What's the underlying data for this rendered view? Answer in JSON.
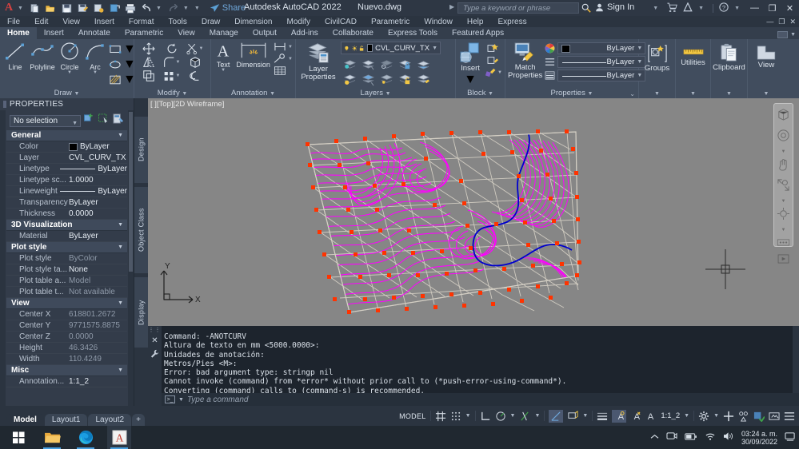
{
  "titlebar": {
    "app_logo": "autocad-A-logo",
    "title": "Autodesk AutoCAD 2022",
    "filename": "Nuevo.dwg",
    "share_label": "Share",
    "search_placeholder": "Type a keyword or phrase",
    "signin_label": "Sign In",
    "quick_access": [
      "new-icon",
      "open-icon",
      "save-icon",
      "saveas-icon",
      "plot-icon",
      "plot-preview-icon",
      "print-icon",
      "undo-icon",
      "redo-icon",
      "customize-icon"
    ],
    "window_buttons": [
      "minimize",
      "restore",
      "close"
    ]
  },
  "menubar": {
    "items": [
      "File",
      "Edit",
      "View",
      "Insert",
      "Format",
      "Tools",
      "Draw",
      "Dimension",
      "Modify",
      "CivilCAD",
      "Parametric",
      "Window",
      "Help",
      "Express"
    ],
    "window_buttons": [
      "minimize",
      "restore",
      "close"
    ]
  },
  "ribbon": {
    "tabs": [
      "Home",
      "Insert",
      "Annotate",
      "Parametric",
      "View",
      "Manage",
      "Output",
      "Add-ins",
      "Collaborate",
      "Express Tools",
      "Featured Apps"
    ],
    "active_tab": "Home",
    "panels": [
      {
        "name": "Draw",
        "title": "Draw",
        "tools": [
          {
            "label": "Line",
            "icon": "line-icon",
            "has_dropdown": false
          },
          {
            "label": "Polyline",
            "icon": "polyline-icon",
            "has_dropdown": false
          },
          {
            "label": "Circle",
            "icon": "circle-icon",
            "has_dropdown": true
          },
          {
            "label": "Arc",
            "icon": "arc-icon",
            "has_dropdown": true
          }
        ],
        "small_tools": [
          "rectangle-icon",
          "ellipse-icon",
          "hatch-icon"
        ]
      },
      {
        "name": "Modify",
        "title": "Modify",
        "small_tools": [
          "move-icon",
          "rotate-icon",
          "trim-icon",
          "copy-icon",
          "mirror-icon",
          "fillet-icon",
          "stretch-icon",
          "scale-icon",
          "array-icon",
          "offset-icon",
          "explode-icon",
          "erase-icon"
        ]
      },
      {
        "name": "Annotation",
        "title": "Annotation",
        "tools": [
          {
            "label": "Text",
            "icon": "text-icon",
            "has_dropdown": true
          },
          {
            "label": "Dimension",
            "icon": "dimension-icon",
            "has_dropdown": false
          }
        ],
        "small_tools": [
          "leader-icon",
          "multileader-icon",
          "table-icon"
        ]
      },
      {
        "name": "Layers",
        "title": "Layers",
        "big_button": {
          "label": "Layer\nProperties",
          "line1": "Layer",
          "line2": "Properties",
          "icon": "layer-properties-icon"
        },
        "layer_combo": {
          "value": "CVL_CURV_TX",
          "color_swatch": "#000000",
          "state_icons": [
            "lightbulb-on-icon",
            "freeze-sun-icon",
            "unlock-icon"
          ]
        },
        "small_tools": [
          "layer-isolate-icon",
          "layer-freeze-icon",
          "layer-off-icon",
          "layer-lock-icon",
          "layer-merge-icon",
          "layer-on-icon",
          "layer-thaw-icon",
          "layer-unisolate-icon",
          "layer-unlock-icon",
          "layer-match-icon"
        ]
      },
      {
        "name": "Block",
        "title": "Block",
        "big_button": {
          "line1": "Insert",
          "line2": "",
          "icon": "insert-block-icon",
          "has_dropdown": true
        },
        "small_tools": [
          "create-block-icon",
          "edit-block-icon",
          "edit-attributes-icon"
        ]
      },
      {
        "name": "Properties",
        "title": "Properties",
        "big_button": {
          "line1": "Match",
          "line2": "Properties",
          "icon": "match-properties-icon"
        },
        "rows": [
          {
            "icon": "color-wheel-icon",
            "swatch": "#000000",
            "value": "ByLayer"
          },
          {
            "icon": "linetype-icon",
            "value": "ByLayer"
          },
          {
            "icon": "lineweight-icon",
            "value": "ByLayer"
          }
        ]
      },
      {
        "name": "Groups",
        "title": "Groups",
        "big_button": {
          "line1": "Groups",
          "icon": "groups-icon"
        }
      },
      {
        "name": "Utilities",
        "title": "Utilities",
        "big_button": {
          "line1": "Utilities",
          "icon": "ruler-icon"
        }
      },
      {
        "name": "Clipboard",
        "title": "Clipboard",
        "big_button": {
          "line1": "Clipboard",
          "icon": "clipboard-icon"
        }
      },
      {
        "name": "View",
        "title": "View",
        "big_button": {
          "line1": "View",
          "icon": "view-icon"
        }
      }
    ]
  },
  "properties_palette": {
    "title": "PROPERTIES",
    "selection": "No selection",
    "toolbar_icons": [
      "quick-select-icon",
      "select-objects-icon",
      "quick-calc-icon"
    ],
    "groups": [
      {
        "name": "General",
        "rows": [
          {
            "key": "Color",
            "value": "ByLayer",
            "type": "color",
            "swatch": "#000000"
          },
          {
            "key": "Layer",
            "value": "CVL_CURV_TX",
            "type": "text"
          },
          {
            "key": "Linetype",
            "value": "ByLayer",
            "type": "line"
          },
          {
            "key": "Linetype sc...",
            "value": "1.0000",
            "type": "text"
          },
          {
            "key": "Lineweight",
            "value": "ByLayer",
            "type": "line"
          },
          {
            "key": "Transparency",
            "value": "ByLayer",
            "type": "text"
          },
          {
            "key": "Thickness",
            "value": "0.0000",
            "type": "text"
          }
        ]
      },
      {
        "name": "3D Visualization",
        "rows": [
          {
            "key": "Material",
            "value": "ByLayer",
            "type": "text"
          }
        ]
      },
      {
        "name": "Plot style",
        "rows": [
          {
            "key": "Plot style",
            "value": "ByColor",
            "type": "dim"
          },
          {
            "key": "Plot style ta...",
            "value": "None",
            "type": "text"
          },
          {
            "key": "Plot table a...",
            "value": "Model",
            "type": "dim"
          },
          {
            "key": "Plot table t...",
            "value": "Not available",
            "type": "dim"
          }
        ]
      },
      {
        "name": "View",
        "rows": [
          {
            "key": "Center X",
            "value": "618801.2672",
            "type": "dim"
          },
          {
            "key": "Center Y",
            "value": "9771575.8875",
            "type": "dim"
          },
          {
            "key": "Center Z",
            "value": "0.0000",
            "type": "dim"
          },
          {
            "key": "Height",
            "value": "46.3426",
            "type": "dim"
          },
          {
            "key": "Width",
            "value": "110.4249",
            "type": "dim"
          }
        ]
      },
      {
        "name": "Misc",
        "rows": [
          {
            "key": "Annotation...",
            "value": "1:1_2",
            "type": "text"
          }
        ]
      }
    ]
  },
  "side_tabs": [
    "Design",
    "Object Class",
    "Display"
  ],
  "canvas": {
    "viewport_label": "[ ][Top][2D Wireframe]",
    "ucs_x_label": "X",
    "ucs_y_label": "Y",
    "background_color": "#868686",
    "contour_color": "#ff00ff",
    "river_color": "#0000cd",
    "triangle_color": "#d4cfc4",
    "point_color": "#ff3300",
    "navbar_icons": [
      "viewcube-icon",
      "steering-wheel-icon",
      "pan-icon",
      "zoom-icon",
      "orbit-icon",
      "showmotion-icon"
    ]
  },
  "command_window": {
    "lines": [
      "Command: -ANOTCURV",
      "Altura de texto en mm <5000.0000>:",
      "Unidades de anotación:",
      "Metros/Pies <M>:",
      "Error: bad argument type: stringp nil",
      "Cannot invoke (command) from *error* without prior call to (*push-error-using-command*).",
      "Converting (command) calls to (command-s) is recommended."
    ],
    "input_placeholder": "Type a command",
    "close_icon": "close-icon",
    "settings_icon": "wrench-icon"
  },
  "statusbar": {
    "layout_tabs": [
      "Model",
      "Layout1",
      "Layout2"
    ],
    "active_layout": "Model",
    "add_layout_label": "+",
    "space_label": "MODEL",
    "scale": "1:1_2",
    "tools": [
      "grid-icon",
      "snap-icon",
      "ortho-icon",
      "polar-icon",
      "isodraft-icon",
      "otrack-icon",
      "lineweight-icon",
      "transparency-icon",
      "selection-cycling-icon",
      "annotation-visibility-icon",
      "autoscale-icon",
      "annotation-scale",
      "workspace-gear-icon",
      "fullscreen-icon",
      "isolate-objects-icon",
      "hardware-acceleration-icon",
      "clean-screen-icon",
      "customization-icon"
    ]
  },
  "taskbar": {
    "apps": [
      "windows-start-icon",
      "file-explorer-icon",
      "edge-browser-icon",
      "autocad-icon"
    ],
    "tray_icons": [
      "show-hidden-icon",
      "teams-icon",
      "battery-icon",
      "wifi-icon",
      "volume-icon",
      "notifications-icon"
    ],
    "clock_time": "03:24 a. m.",
    "clock_date": "30/09/2022"
  }
}
